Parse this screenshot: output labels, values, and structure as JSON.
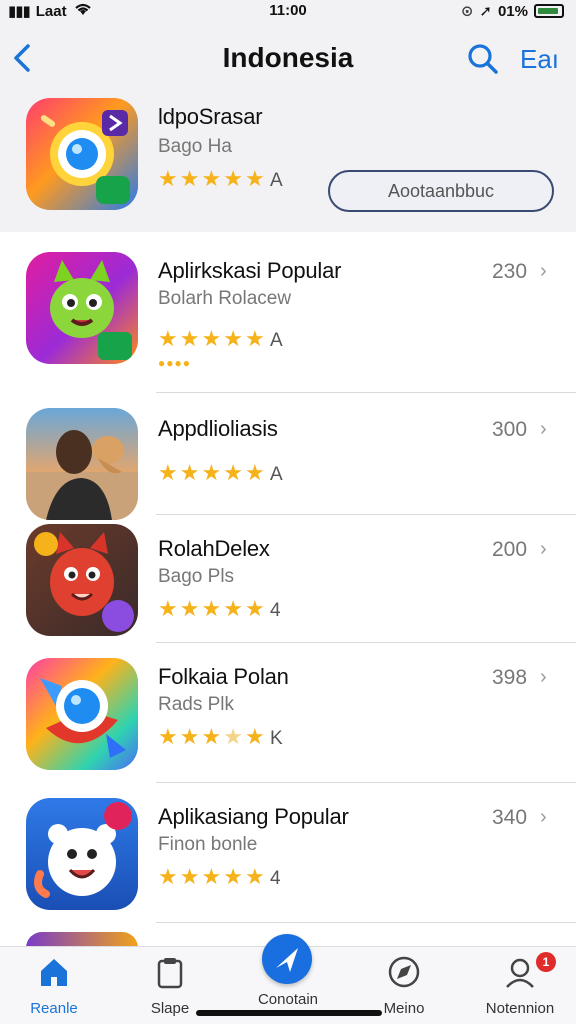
{
  "status": {
    "carrier": "Laat",
    "time": "11:00",
    "battery": "01%"
  },
  "nav": {
    "back_icon": "chevron-left-icon",
    "title": "Indonesia",
    "right_text": "Eaı"
  },
  "featured": {
    "name": "ldpoSrasar",
    "sub": "Bago Ha",
    "rating": 5,
    "rating_letter": "A",
    "open_label": "Aootaanbbuc"
  },
  "apps": [
    {
      "name": "Aplirkskasi Popular",
      "sub": "Bolarh Rolacew",
      "rating": 5,
      "letter": "A",
      "count": "230",
      "extra": "●●●●"
    },
    {
      "name": "Appdlioliasis",
      "sub": "",
      "rating": 5,
      "letter": "A",
      "count": "300"
    },
    {
      "name": "RolahDelex",
      "sub": "Bago Pls",
      "rating": 5,
      "letter": "4",
      "count": "200"
    },
    {
      "name": "Folkaia Polan",
      "sub": "Rads Plk",
      "rating": 3.5,
      "letter": "K",
      "count": "398"
    },
    {
      "name": "Aplikasiang Popular",
      "sub": "Finon bonle",
      "rating": 5,
      "letter": "4",
      "count": "340"
    }
  ],
  "tabs": [
    {
      "label": "Reanle",
      "icon": "home-icon",
      "active": true
    },
    {
      "label": "Slape",
      "icon": "clipboard-icon",
      "active": false
    },
    {
      "label": "Conotain",
      "icon": "paper-plane-icon",
      "active": false
    },
    {
      "label": "Meino",
      "icon": "compass-icon",
      "active": false
    },
    {
      "label": "Notennion",
      "icon": "person-icon",
      "active": false,
      "badge": "1"
    }
  ],
  "colors": {
    "accent": "#1a73d9",
    "star": "#f6b21a"
  }
}
